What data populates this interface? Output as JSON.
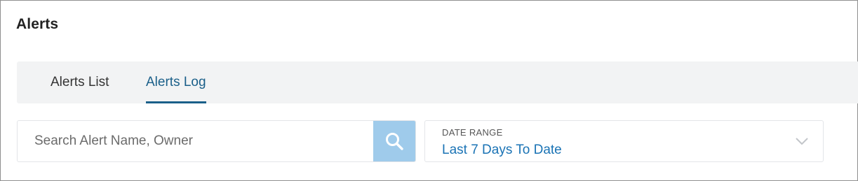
{
  "header": {
    "title": "Alerts"
  },
  "tabs": [
    {
      "label": "Alerts List",
      "active": false
    },
    {
      "label": "Alerts Log",
      "active": true
    }
  ],
  "search": {
    "placeholder": "Search Alert Name, Owner",
    "value": "",
    "button_icon": "search-icon"
  },
  "date_range": {
    "label": "DATE RANGE",
    "value": "Last 7 Days To Date",
    "icon": "chevron-down-icon"
  },
  "colors": {
    "accent": "#1a5f89",
    "link": "#1a73b5",
    "search_button": "#9fcbeb",
    "tabbar_bg": "#f2f3f4"
  }
}
